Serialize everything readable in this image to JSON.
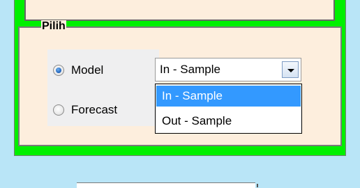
{
  "group": {
    "title": "Pilih"
  },
  "radios": {
    "model": {
      "label": "Model",
      "checked": true
    },
    "forecast": {
      "label": "Forecast",
      "checked": false
    }
  },
  "combo": {
    "selected": "In - Sample",
    "options": [
      "In - Sample",
      "Out - Sample"
    ],
    "highlighted_index": 0
  },
  "colors": {
    "background": "#b9e5f7",
    "frame_green": "#00f000",
    "panel": "#fdeedd",
    "highlight": "#3399ff"
  }
}
